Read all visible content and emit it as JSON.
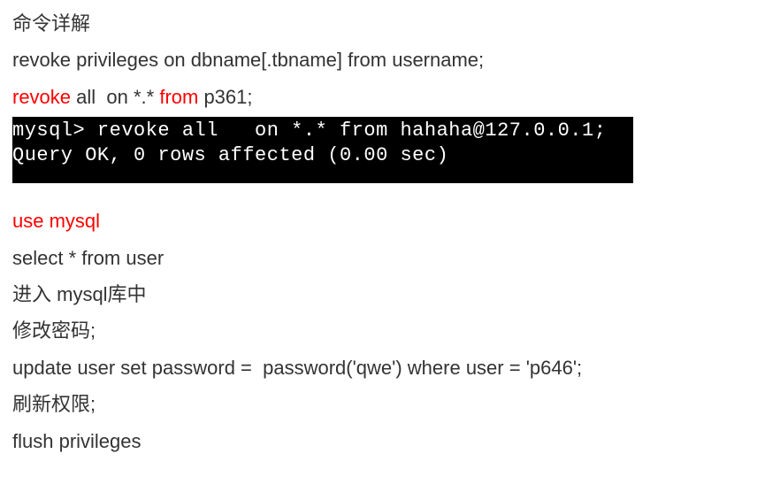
{
  "lines": {
    "l1": "命令详解",
    "l2": "revoke privileges on dbname[.tbname] from username;",
    "l3": {
      "a": "revoke",
      "b": " all  on *.* ",
      "c": "from",
      "d": " p361;"
    },
    "term1": "mysql> revoke all   on *.* from hahaha@127.0.0.1;",
    "term2": "Query OK, 0 rows affected (0.00 sec)",
    "l5": "use mysql",
    "l6": "select * from user",
    "l7": "进入 mysql库中",
    "l8": "修改密码;",
    "l9": "update user set password =  password('qwe') where user = 'p646';",
    "l10": "刷新权限;",
    "l11": "flush privileges"
  }
}
